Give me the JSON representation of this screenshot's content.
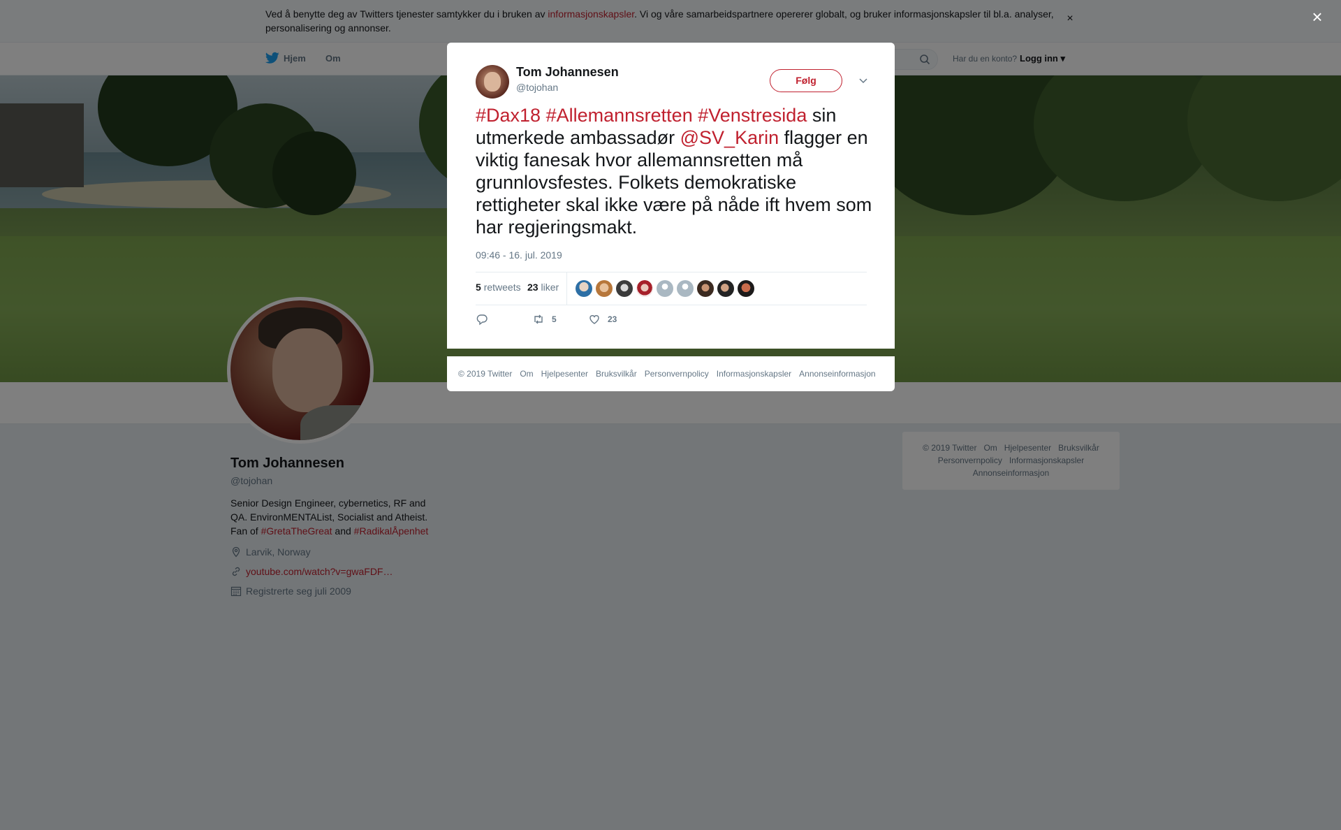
{
  "cookie": {
    "text_before": "Ved å benytte deg av Twitters tjenester samtykker du i bruken av ",
    "link": "informasjonskapsler",
    "text_after": ". Vi og våre samarbeidspartnere opererer globalt, og bruker informasjonskapsler til bl.a. analyser, personalisering og annonser.",
    "close": "×"
  },
  "nav": {
    "home": "Hjem",
    "about": "Om",
    "account_question": "Har du en konto?",
    "login": "Logg inn"
  },
  "profile": {
    "name": "Tom Johannesen",
    "handle": "@tojohan",
    "bio_text": "Senior Design Engineer, cybernetics, RF and QA. EnvironMENTAList, Socialist and Atheist. Fan of ",
    "bio_tag1": "#GretaTheGreat",
    "bio_and": " and ",
    "bio_tag2": "#RadikalÅpenhet",
    "location": "Larvik, Norway",
    "url": "youtube.com/watch?v=gwaFDF…",
    "joined": "Registrerte seg juli 2009"
  },
  "footer_links": [
    "© 2019 Twitter",
    "Om",
    "Hjelpesenter",
    "Bruksvilkår",
    "Personvernpolicy",
    "Informasjonskapsler",
    "Annonseinformasjon"
  ],
  "tweet": {
    "name": "Tom Johannesen",
    "handle": "@tojohan",
    "follow": "Følg",
    "tag1": "#Dax18",
    "tag2": "#Allemannsretten",
    "tag3": "#Venstresida",
    "text1": " sin utmerkede ambassadør ",
    "mention": "@SV_Karin",
    "text2": " flagger en viktig fanesak hvor allemannsretten må grunnlovsfestes. Folkets demokratiske rettigheter skal ikke være på nåde ift hvem som har regjeringsmakt.",
    "time": "09:46 - 16. jul. 2019",
    "retweets_count": "5",
    "retweets_label": "retweets",
    "likes_count": "23",
    "likes_label": "liker",
    "action_retweets": "5",
    "action_likes": "23"
  },
  "overlay_close": "×",
  "colors": {
    "accent": "#c0212f",
    "secondary_text": "#657786"
  }
}
